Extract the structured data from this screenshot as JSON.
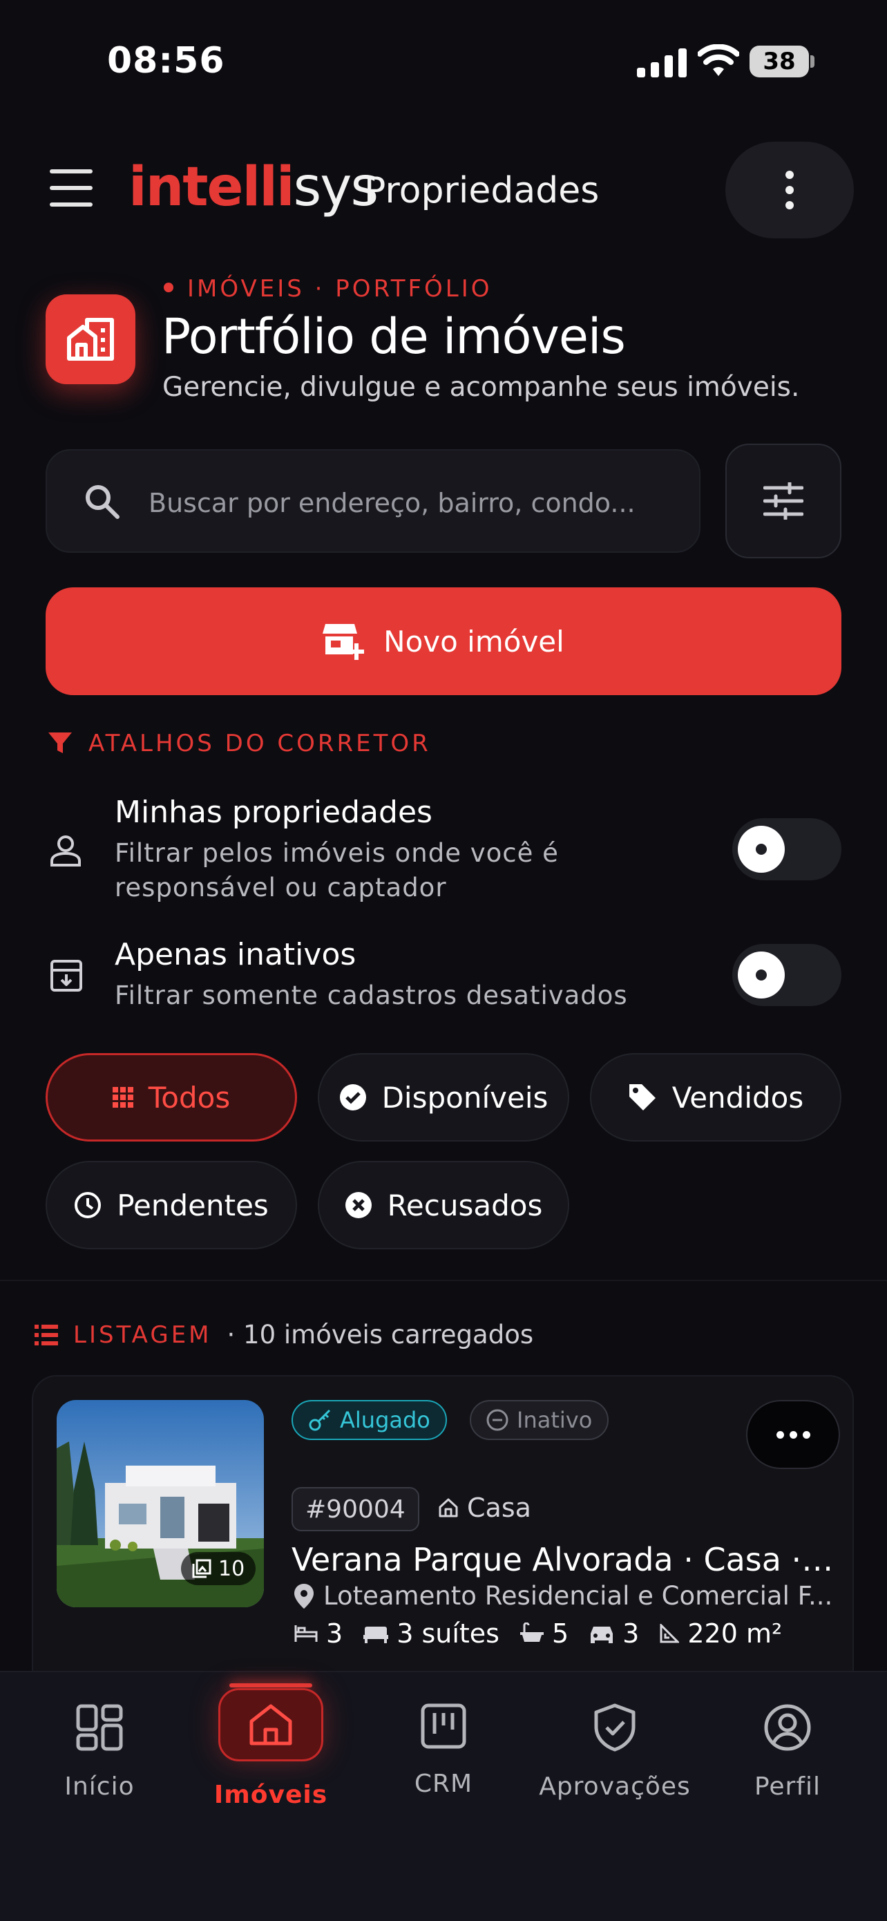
{
  "status": {
    "time": "08:56",
    "battery": "38"
  },
  "header": {
    "logo_red": "intelli",
    "logo_white": "sys",
    "title": "Propriedades"
  },
  "page": {
    "eyebrow": "IMÓVEIS · PORTFÓLIO",
    "title": "Portfólio de imóveis",
    "subtitle": "Gerencie, divulgue e acompanhe seus imóveis."
  },
  "search": {
    "placeholder": "Buscar por endereço, bairro, condo..."
  },
  "new_button": {
    "label": "Novo imóvel"
  },
  "shortcuts": {
    "label": "ATALHOS DO CORRETOR",
    "items": [
      {
        "title": "Minhas propriedades",
        "desc1": "Filtrar pelos imóveis onde você é",
        "desc2": "responsável ou captador",
        "on": false
      },
      {
        "title": "Apenas inativos",
        "desc1": "Filtrar somente cadastros desativados",
        "on": false
      }
    ]
  },
  "filters": [
    {
      "label": "Todos",
      "icon": "grid-icon",
      "active": true
    },
    {
      "label": "Disponíveis",
      "icon": "check-circle-icon"
    },
    {
      "label": "Vendidos",
      "icon": "tag-icon"
    },
    {
      "label": "Pendentes",
      "icon": "clock-icon"
    },
    {
      "label": "Recusados",
      "icon": "x-circle-icon"
    }
  ],
  "listing": {
    "label": "LISTAGEM",
    "count": "· 10 imóveis carregados",
    "card": {
      "photo_count": "10",
      "badge_rented": "Alugado",
      "badge_inactive": "Inativo",
      "code": "#90004",
      "type": "Casa",
      "title": "Verana Parque Alvorada · Casa · Pi...",
      "address": "Loteamento Residencial e Comercial F...",
      "bedrooms": "3",
      "suites": "3 suítes",
      "bathrooms": "5",
      "parking": "3",
      "area": "220 m²"
    }
  },
  "nav": [
    {
      "label": "Início",
      "icon": "dashboard-icon"
    },
    {
      "label": "Imóveis",
      "icon": "home-icon",
      "active": true
    },
    {
      "label": "CRM",
      "icon": "kanban-icon"
    },
    {
      "label": "Aprovações",
      "icon": "shield-check-icon"
    },
    {
      "label": "Perfil",
      "icon": "user-circle-icon"
    }
  ],
  "colors": {
    "accent": "#e53935",
    "background": "#0c0c11",
    "rented": "#35c6d8"
  }
}
